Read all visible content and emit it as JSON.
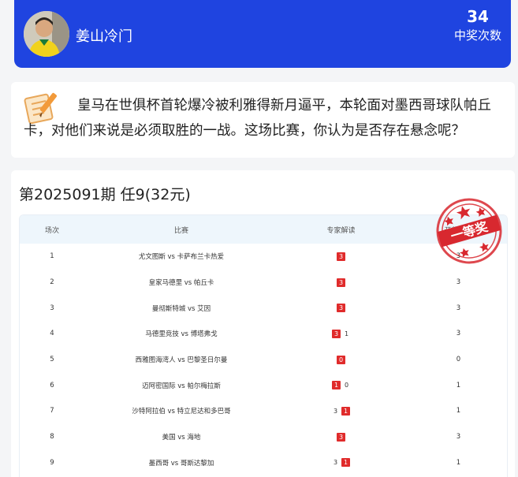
{
  "header": {
    "username": "姜山冷门",
    "win_count": "34",
    "win_count_label": "中奖次数"
  },
  "question": {
    "text": "皇马在世俱杯首轮爆冷被利雅得新月逼平，本轮面对墨西哥球队帕丘卡，对他们来说是必须取胜的一战。这场比赛，你认为是否存在悬念呢？"
  },
  "result": {
    "period_title": "第2025091期 任9(32元)",
    "stamp_text": "一等奖",
    "columns": [
      "场次",
      "比赛",
      "专家解读",
      "开奖结果"
    ],
    "rows": [
      {
        "no": "1",
        "match": "尤文图斯 vs 卡萨布兰卡热爱",
        "picks": [
          {
            "v": "3",
            "hit": true
          }
        ],
        "result": "3"
      },
      {
        "no": "2",
        "match": "皇家马德里 vs 帕丘卡",
        "picks": [
          {
            "v": "3",
            "hit": true
          }
        ],
        "result": "3"
      },
      {
        "no": "3",
        "match": "曼彻斯特城 vs 艾因",
        "picks": [
          {
            "v": "3",
            "hit": true
          }
        ],
        "result": "3"
      },
      {
        "no": "4",
        "match": "马德里竞技 vs 博塔弗戈",
        "picks": [
          {
            "v": "3",
            "hit": true
          },
          {
            "v": "1",
            "hit": false
          }
        ],
        "result": "3"
      },
      {
        "no": "5",
        "match": "西雅图海湾人 vs 巴黎圣日尔曼",
        "picks": [
          {
            "v": "0",
            "hit": true
          }
        ],
        "result": "0"
      },
      {
        "no": "6",
        "match": "迈阿密国际 vs 帕尔梅拉斯",
        "picks": [
          {
            "v": "1",
            "hit": true
          },
          {
            "v": "0",
            "hit": false
          }
        ],
        "result": "1"
      },
      {
        "no": "7",
        "match": "沙特阿拉伯 vs 特立尼达和多巴哥",
        "picks": [
          {
            "v": "3",
            "hit": false
          },
          {
            "v": "1",
            "hit": true
          }
        ],
        "result": "1"
      },
      {
        "no": "8",
        "match": "美国 vs 海地",
        "picks": [
          {
            "v": "3",
            "hit": true
          }
        ],
        "result": "3"
      },
      {
        "no": "9",
        "match": "墨西哥 vs 哥斯达黎加",
        "picks": [
          {
            "v": "3",
            "hit": false
          },
          {
            "v": "1",
            "hit": true
          }
        ],
        "result": "1"
      }
    ]
  },
  "colors": {
    "header_bg": "#1f44e0",
    "hit_badge": "#e02b2b",
    "stamp": "#d8282f"
  }
}
